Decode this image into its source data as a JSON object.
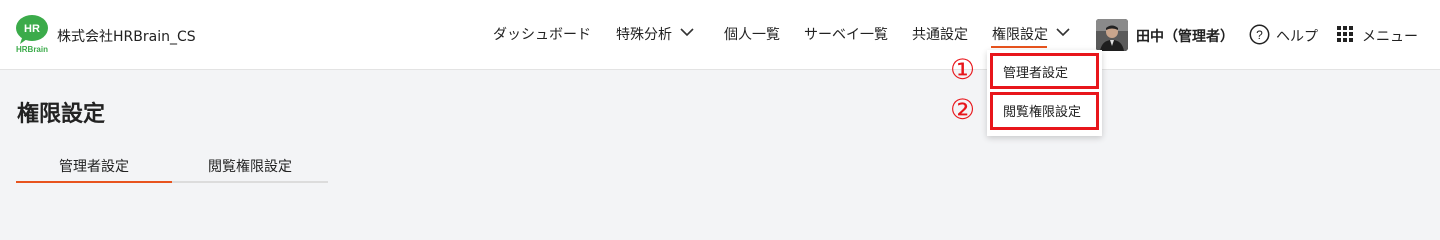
{
  "header": {
    "logo_text_top": "HR",
    "logo_text_bottom": "HRBrain",
    "company": "株式会社HRBrain_CS"
  },
  "nav": {
    "items": [
      {
        "label": "ダッシュボード"
      },
      {
        "label": "特殊分析"
      },
      {
        "label": "個人一覧"
      },
      {
        "label": "サーベイ一覧"
      },
      {
        "label": "共通設定"
      },
      {
        "label": "権限設定"
      }
    ],
    "active": "権限設定"
  },
  "user": {
    "name": "田中（管理者）",
    "help_label": "ヘルプ",
    "menu_label": "メニュー"
  },
  "dropdown": {
    "items": [
      {
        "marker": "①",
        "label": "管理者設定"
      },
      {
        "marker": "②",
        "label": "閲覧権限設定"
      }
    ]
  },
  "page": {
    "title": "権限設定",
    "tabs": [
      {
        "label": "管理者設定"
      },
      {
        "label": "閲覧権限設定"
      }
    ],
    "active_tab": "管理者設定"
  },
  "colors": {
    "accent": "#e8541e",
    "annotation_red": "#e8161b",
    "brand_green": "#3bab4a"
  }
}
